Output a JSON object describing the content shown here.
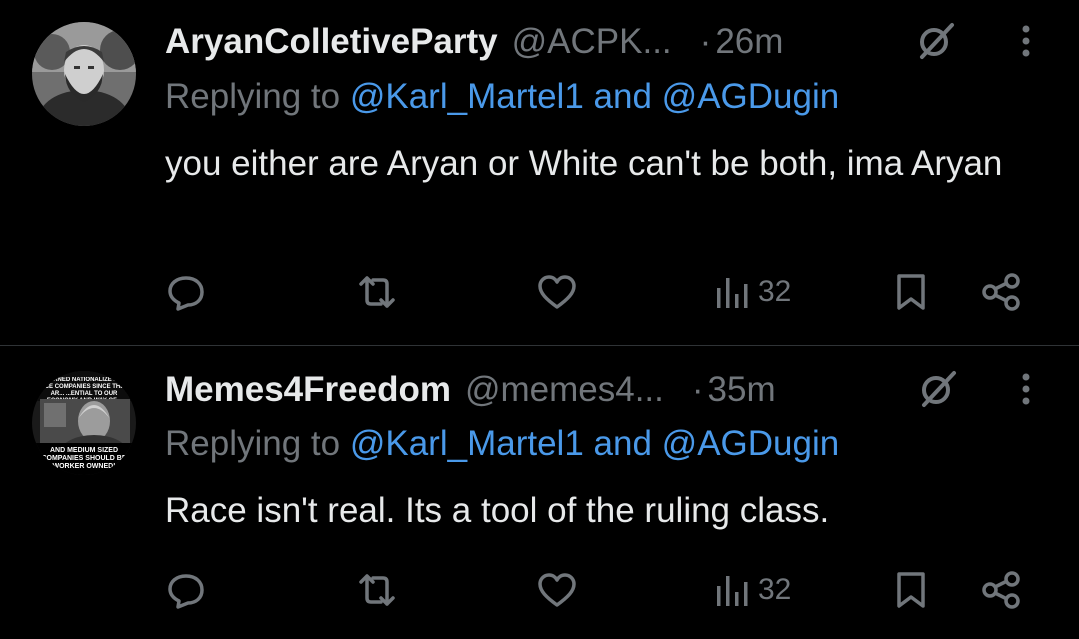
{
  "tweets": [
    {
      "display_name": "AryanColletiveParty",
      "handle": "@ACPK...",
      "separator": "·",
      "time": "26m",
      "replying_prefix": "Replying to",
      "mention1": "@Karl_Martel1",
      "conjunction": "and",
      "mention2": "@AGDugin",
      "text": "you either are Aryan or White can't be both, ima Aryan",
      "views": "32",
      "icons": {
        "grok": "grok-icon",
        "more": "more-icon",
        "reply": "reply-icon",
        "retweet": "retweet-icon",
        "like": "like-icon",
        "views": "views-icon",
        "bookmark": "bookmark-icon",
        "share": "share-icon"
      }
    },
    {
      "display_name": "Memes4Freedom",
      "handle": "@memes4...",
      "separator": "·",
      "time": "35m",
      "replying_prefix": "Replying to",
      "mention1": "@Karl_Martel1",
      "conjunction": "and",
      "mention2": "@AGDugin",
      "text": "Race isn't real. Its a tool of the ruling class.",
      "views": "32",
      "avatar_text_top": "...ORNED NATIONALIZE IN... ...CE COMPANIES SINCE THEY AR... ...ENTIAL TO OUR ECONOMY AND WAY OF...",
      "avatar_text_bottom": "AND MEDIUM SIZED COMPANIES SHOULD BE WORKER OWNED!"
    }
  ],
  "colors": {
    "background": "#000000",
    "text_primary": "#e7e9ea",
    "text_secondary": "#71767b",
    "link": "#4a99e9",
    "divider": "#2f3336"
  }
}
